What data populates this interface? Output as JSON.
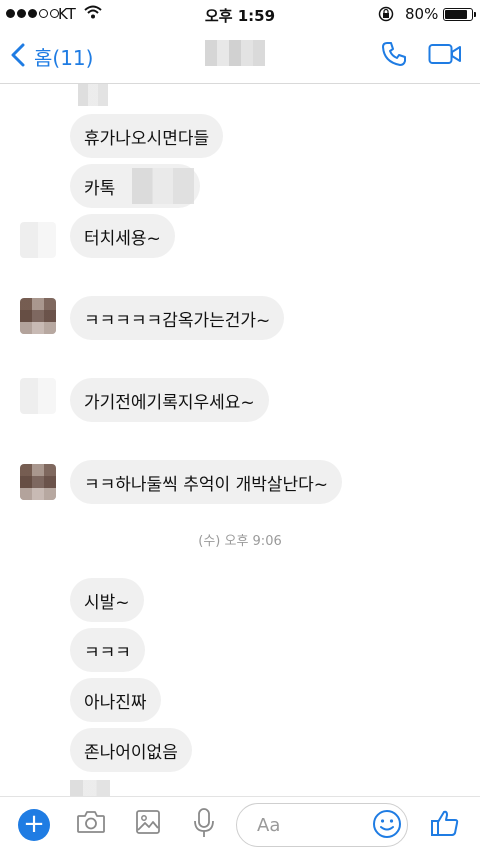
{
  "status_bar": {
    "carrier": "KT",
    "time": "오후 1:59",
    "battery": "80%"
  },
  "nav": {
    "back_label": "홈(11)"
  },
  "messages": [
    {
      "text": "휴가나오시면다들"
    },
    {
      "text": "카톡"
    },
    {
      "text": "터치세용~"
    },
    {
      "text": "ㅋㅋㅋㅋㅋ감옥가는건가~"
    },
    {
      "text": "가기전에기록지우세요~"
    },
    {
      "text": "ㅋㅋ하나둘씩 추억이 개박살난다~"
    },
    {
      "text": "시발~"
    },
    {
      "text": "ㅋㅋㅋ"
    },
    {
      "text": "아나진짜"
    },
    {
      "text": "존나어이없음"
    }
  ],
  "timestamp": "(수) 오후 9:06",
  "composer": {
    "placeholder": "Aa",
    "plus_label": "+"
  },
  "colors": {
    "accent": "#1f7ce3",
    "bubble": "#f0f0f0",
    "timestamp": "#9a9a9a"
  },
  "icons": [
    "back-chevron-icon",
    "phone-icon",
    "video-icon",
    "plus-icon",
    "camera-icon",
    "image-icon",
    "mic-icon",
    "emoji-icon",
    "like-icon"
  ]
}
